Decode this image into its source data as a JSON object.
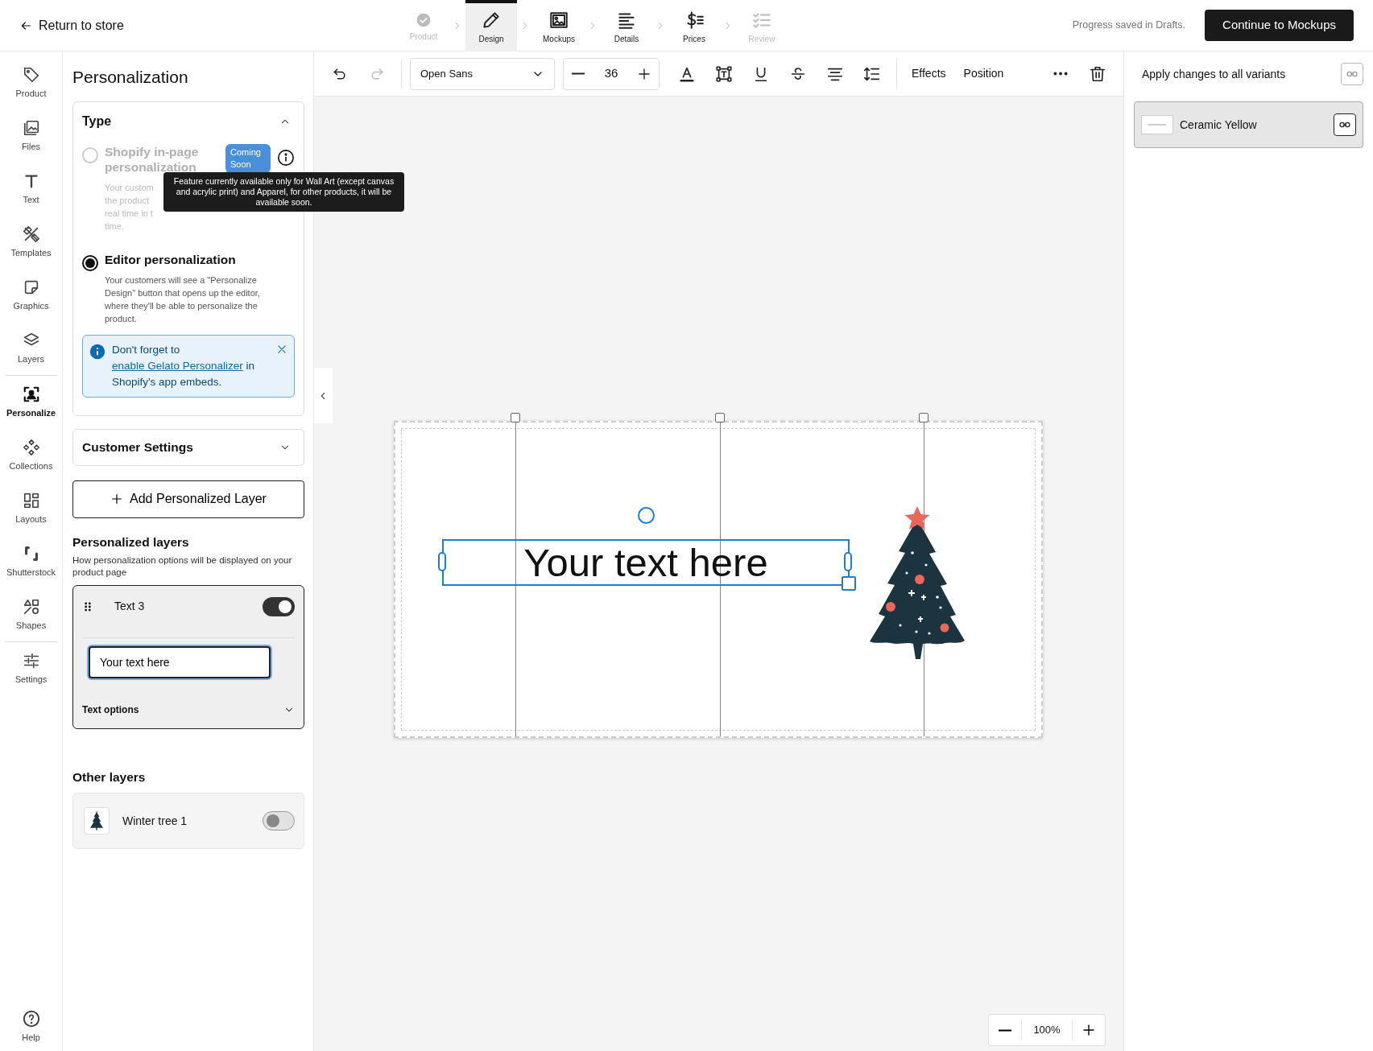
{
  "top_bar": {
    "back_link": "Return to store",
    "steps": [
      {
        "label": "Product",
        "selected": false,
        "disabled": true
      },
      {
        "label": "Design",
        "selected": true,
        "disabled": false
      },
      {
        "label": "Mockups",
        "selected": false,
        "disabled": false
      },
      {
        "label": "Details",
        "selected": false,
        "disabled": false
      },
      {
        "label": "Prices",
        "selected": false,
        "disabled": false
      },
      {
        "label": "Review",
        "selected": false,
        "disabled": true
      }
    ],
    "save_status": "Progress saved in Drafts.",
    "primary_button": "Continue to Mockups"
  },
  "sidebar": {
    "groups": [
      {
        "items": [
          {
            "label": "Product",
            "selected": false
          },
          {
            "label": "Files",
            "selected": false
          },
          {
            "label": "Text",
            "selected": false
          },
          {
            "label": "Templates",
            "selected": false
          },
          {
            "label": "Graphics",
            "selected": false
          },
          {
            "label": "Layers",
            "selected": false
          }
        ]
      },
      {
        "items": [
          {
            "label": "Personalize",
            "selected": true
          },
          {
            "label": "Collections",
            "selected": false
          },
          {
            "label": "Layouts",
            "selected": false
          },
          {
            "label": "Shutterstock",
            "selected": false
          },
          {
            "label": "Shapes",
            "selected": false
          }
        ]
      },
      {
        "items": [
          {
            "label": "Settings",
            "selected": false
          }
        ]
      }
    ],
    "help": "Help"
  },
  "panel": {
    "title": "Personalization",
    "type_section": {
      "title": "Type",
      "expanded": true,
      "options": [
        {
          "title": "Shopify in-page personalization",
          "selected": false,
          "disabled": true,
          "badge": "Coming Soon",
          "description_lines": [
            "Your custom",
            "the product",
            "real time in t",
            "time."
          ]
        },
        {
          "title": "Editor personalization",
          "selected": true,
          "disabled": false,
          "description": "Your customers will see a \"Personalize Design\" button that opens up the editor, where they'll be able to personalize the product."
        }
      ],
      "tooltip": "Feature currently available only for Wall Art (except canvas and acrylic print) and Apparel, for other products, it will be available soon.",
      "alert": {
        "before": "Don't forget to",
        "link": "enable Gelato Personalizer",
        "after": "in Shopify's app embeds."
      }
    },
    "customer_settings": {
      "title": "Customer Settings",
      "expanded": false
    },
    "add_button": "Add Personalized Layer",
    "personalized_layers": {
      "title": "Personalized layers",
      "description": "How personalization options will be displayed on your product page",
      "items": [
        {
          "name": "Text 3",
          "on": true,
          "value": "Your text here",
          "options_label": "Text options",
          "options_expanded": false
        }
      ]
    },
    "other_layers": {
      "title": "Other layers",
      "items": [
        {
          "name": "Winter tree 1",
          "on": false
        }
      ]
    }
  },
  "toolbar": {
    "undo": {
      "disabled": false
    },
    "redo": {
      "disabled": true
    },
    "font": "Open Sans",
    "font_size": "36",
    "buttons": [
      "Effects",
      "Position"
    ]
  },
  "canvas": {
    "text": "Your text here",
    "zoom": "100%"
  },
  "right_panel": {
    "apply_label": "Apply changes to all variants",
    "variants": [
      {
        "name": "Ceramic Yellow",
        "selected": true
      }
    ]
  }
}
